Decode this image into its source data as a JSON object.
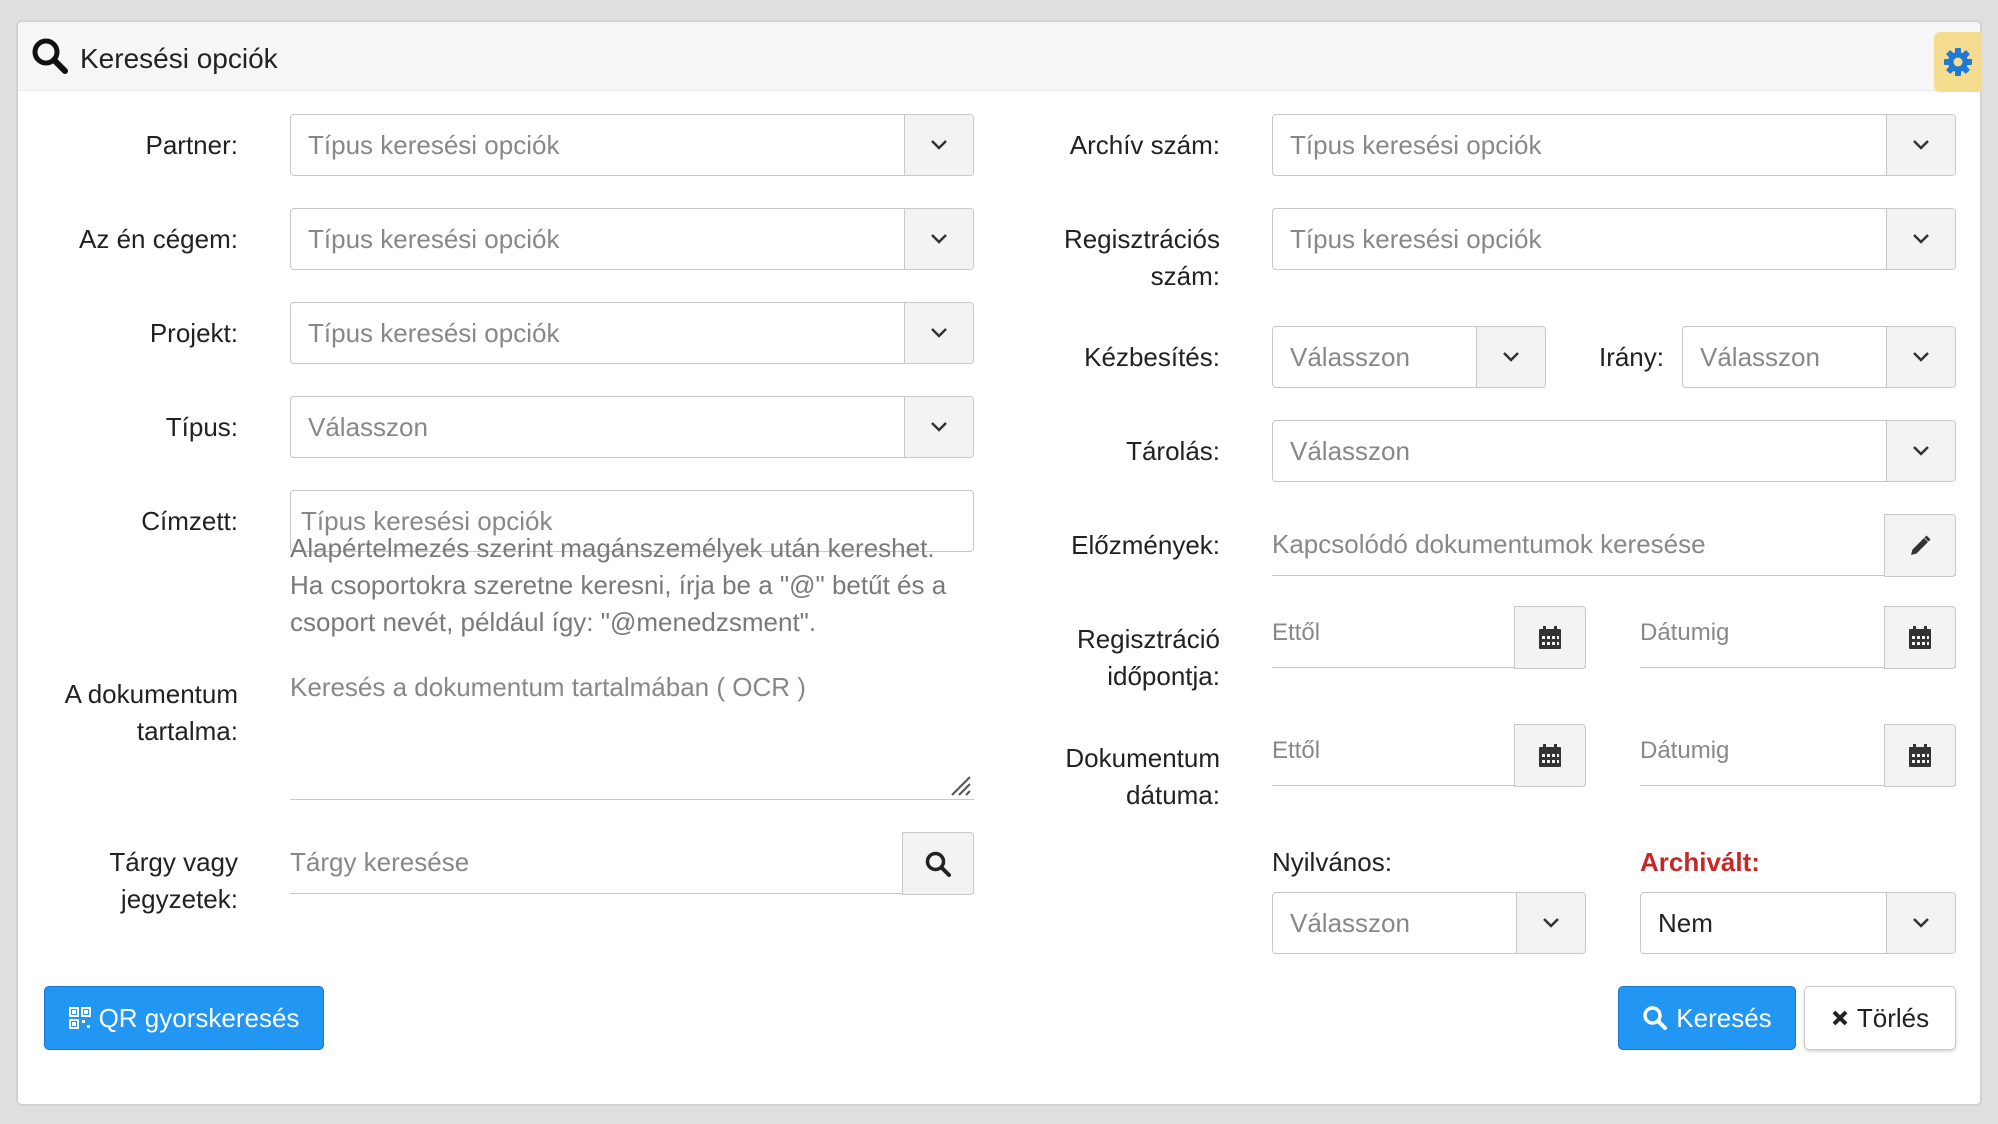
{
  "header": {
    "title": "Keresési opciók",
    "title_icon": "search-icon",
    "settings_icon": "gear-icon"
  },
  "left": {
    "partner": {
      "label": "Partner:",
      "placeholder": "Típus keresési opciók"
    },
    "my_company": {
      "label": "Az én cégem:",
      "placeholder": "Típus keresési opciók"
    },
    "project": {
      "label": "Projekt:",
      "placeholder": "Típus keresési opciók"
    },
    "type": {
      "label": "Típus:",
      "placeholder": "Válasszon"
    },
    "recipient": {
      "label": "Címzett:",
      "placeholder": "Típus keresési opciók",
      "help": "Alapértelmezés szerint magánszemélyek után kereshet. Ha csoportokra szeretne keresni, írja be a \"@\" betűt és a csoport nevét, például így: \"@menedzsment\"."
    },
    "content": {
      "label_line1": "A dokumentum",
      "label_line2": "tartalma:",
      "placeholder": "Keresés a dokumentum tartalmában ( OCR )"
    },
    "subject": {
      "label_line1": "Tárgy vagy",
      "label_line2": "jegyzetek:",
      "placeholder": "Tárgy keresése"
    }
  },
  "right": {
    "archive_number": {
      "label": "Archív szám:",
      "placeholder": "Típus keresési opciók"
    },
    "registration_number": {
      "label_line1": "Regisztrációs",
      "label_line2": "szám:",
      "placeholder": "Típus keresési opciók"
    },
    "delivery": {
      "label": "Kézbesítés:",
      "placeholder": "Válasszon"
    },
    "direction": {
      "label": "Irány:",
      "placeholder": "Válasszon"
    },
    "storage": {
      "label": "Tárolás:",
      "placeholder": "Válasszon"
    },
    "history": {
      "label": "Előzmények:",
      "placeholder": "Kapcsolódó dokumentumok keresése"
    },
    "registration_date": {
      "label_line1": "Regisztráció",
      "label_line2": "időpontja:",
      "from_placeholder": "Ettől",
      "to_placeholder": "Dátumig"
    },
    "document_date": {
      "label_line1": "Dokumentum",
      "label_line2": "dátuma:",
      "from_placeholder": "Ettől",
      "to_placeholder": "Dátumig"
    },
    "public": {
      "label": "Nyilvános:",
      "placeholder": "Válasszon"
    },
    "archived": {
      "label": "Archivált:",
      "value": "Nem",
      "label_color": "#c62828"
    }
  },
  "buttons": {
    "qr": "QR gyorskeresés",
    "search": "Keresés",
    "clear": "Törlés"
  },
  "colors": {
    "primary": "#2196f3",
    "settings_tab": "#f5dc8e"
  }
}
